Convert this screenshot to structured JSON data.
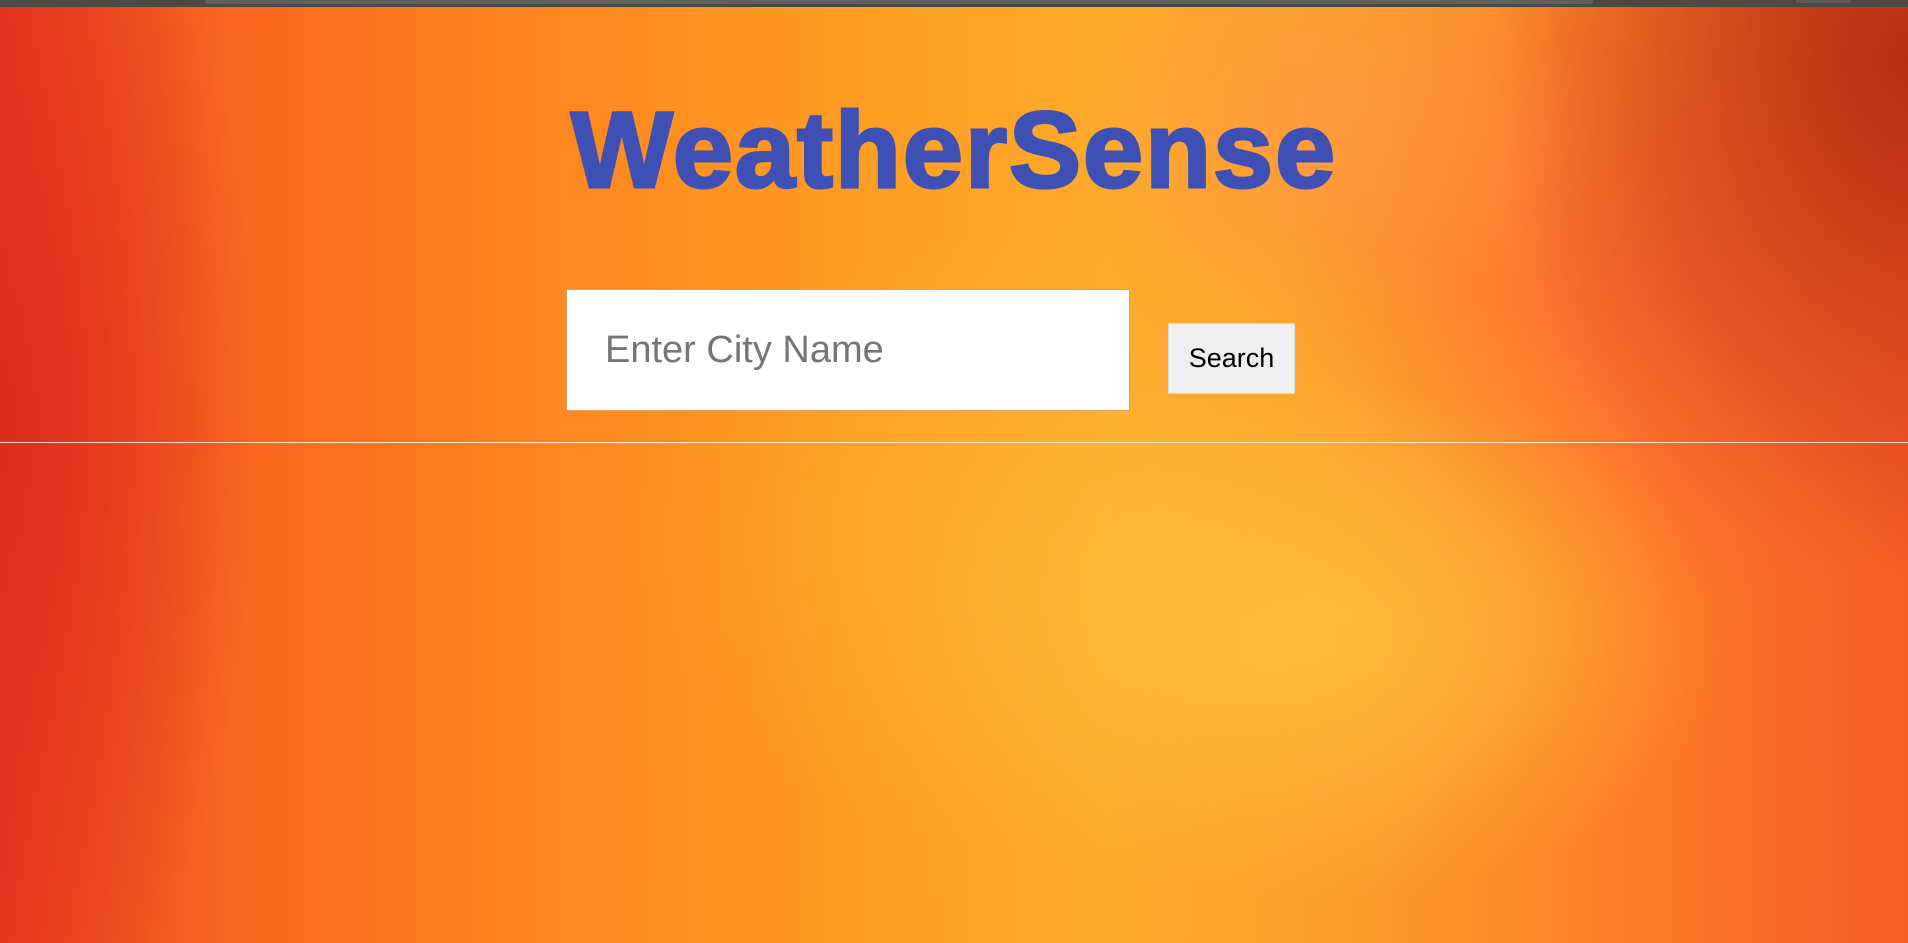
{
  "header": {
    "title": "WeatherSense"
  },
  "search": {
    "value": "",
    "placeholder": "Enter City Name",
    "button_label": "Search"
  },
  "colors": {
    "title": "#3f50b5",
    "background_primary": "#fd8520",
    "background_highlight": "#fdb530",
    "background_edge": "#e4381f",
    "input_background": "#ffffff",
    "button_background": "#efefef"
  }
}
